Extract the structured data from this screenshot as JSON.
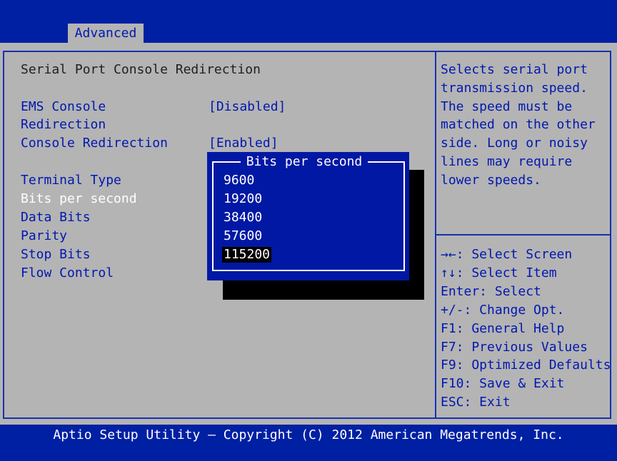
{
  "header": {
    "active_tab": "Advanced"
  },
  "main": {
    "section_title": "Serial Port Console Redirection",
    "settings": [
      {
        "label": "EMS Console",
        "value": "[Disabled]"
      },
      {
        "label": "Redirection",
        "value": ""
      },
      {
        "label": "Console Redirection",
        "value": "[Enabled]"
      },
      {
        "label": "Terminal Type",
        "value": ""
      },
      {
        "label": "Bits per second",
        "value": ""
      },
      {
        "label": "Data Bits",
        "value": ""
      },
      {
        "label": "Parity",
        "value": ""
      },
      {
        "label": "Stop Bits",
        "value": ""
      },
      {
        "label": "Flow Control",
        "value": ""
      }
    ]
  },
  "popup": {
    "title": "Bits per second",
    "options": [
      "9600",
      "19200",
      "38400",
      "57600",
      "115200"
    ],
    "selected": "115200"
  },
  "help": {
    "description": [
      "Selects serial port",
      "transmission speed.",
      "The speed must be",
      "matched on the other",
      "side. Long or noisy",
      "lines may require",
      "lower speeds."
    ],
    "keys": [
      "→←: Select Screen",
      "↑↓: Select Item",
      "Enter: Select",
      "+/-: Change Opt.",
      "F1: General Help",
      "F7: Previous Values",
      "F9: Optimized Defaults",
      "F10: Save & Exit",
      "ESC: Exit"
    ]
  },
  "footer": {
    "text": "Aptio Setup Utility – Copyright (C) 2012 American Megatrends, Inc."
  },
  "colors": {
    "background": "#0020a4",
    "panel": "#b4b4b4",
    "accent_blue": "#0018b0",
    "popup_bg": "#0018a4",
    "highlight": "#000000"
  }
}
